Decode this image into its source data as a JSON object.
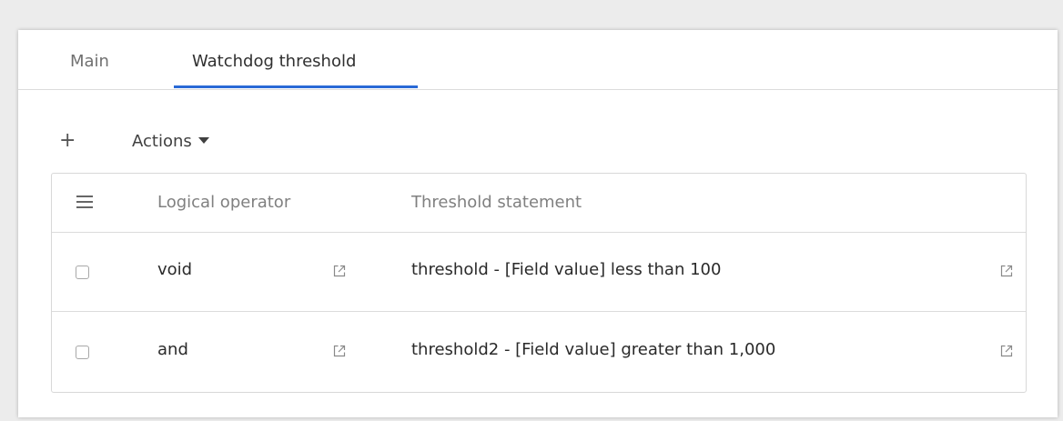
{
  "tabs": [
    {
      "label": "Main",
      "active": false
    },
    {
      "label": "Watchdog threshold",
      "active": true
    }
  ],
  "toolbar": {
    "add_label": "+",
    "actions_label": "Actions"
  },
  "grid": {
    "columns": [
      "Logical operator",
      "Threshold statement"
    ],
    "rows": [
      {
        "logical_operator": "void",
        "threshold_statement": "threshold - [Field value] less than 100"
      },
      {
        "logical_operator": "and",
        "threshold_statement": "threshold2 - [Field value] greater than 1,000"
      }
    ]
  },
  "colors": {
    "accent": "#2a6ad6",
    "background": "#ececec",
    "panel": "#ffffff"
  },
  "icons": [
    "menu-icon",
    "caret-down-icon",
    "external-link-icon"
  ]
}
